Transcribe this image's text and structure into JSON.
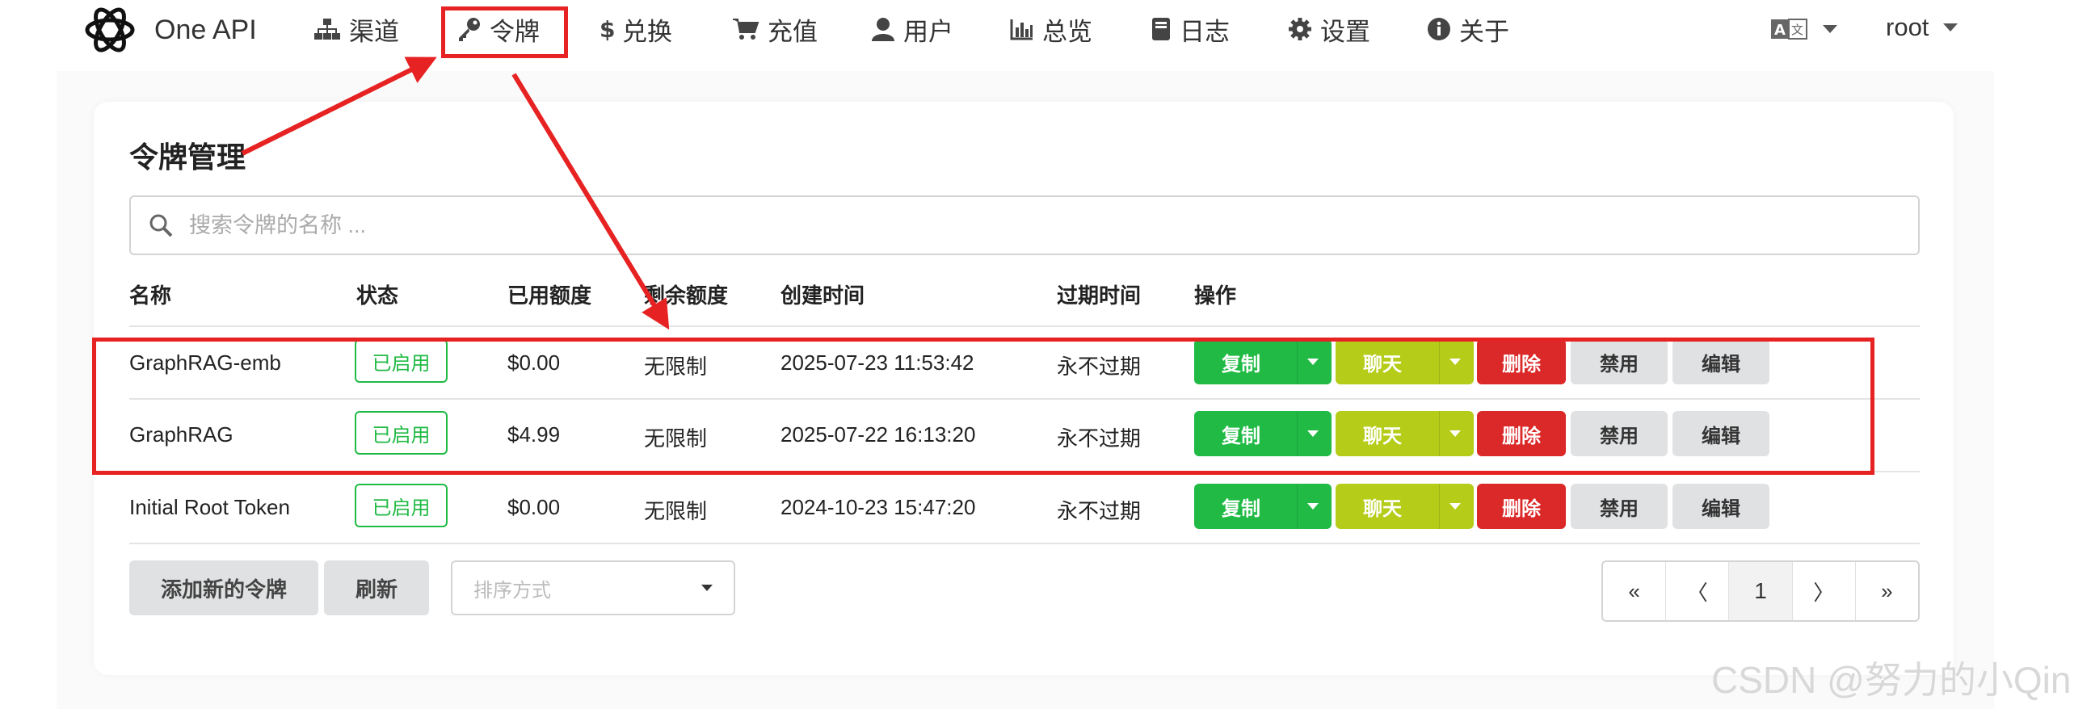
{
  "header": {
    "brand": "One API",
    "nav": [
      {
        "label": "渠道",
        "icon": "sitemap-icon"
      },
      {
        "label": "令牌",
        "icon": "key-icon"
      },
      {
        "label": "兑换",
        "icon": "dollar-icon"
      },
      {
        "label": "充值",
        "icon": "cart-icon"
      },
      {
        "label": "用户",
        "icon": "user-icon"
      },
      {
        "label": "总览",
        "icon": "bar-chart-icon"
      },
      {
        "label": "日志",
        "icon": "book-icon"
      },
      {
        "label": "设置",
        "icon": "gear-icon"
      },
      {
        "label": "关于",
        "icon": "info-icon"
      }
    ],
    "language_icon": "translate-icon",
    "user": "root"
  },
  "page": {
    "title": "令牌管理",
    "search_placeholder": "搜索令牌的名称 ..."
  },
  "table": {
    "columns": [
      "名称",
      "状态",
      "已用额度",
      "剩余额度",
      "创建时间",
      "过期时间",
      "操作"
    ],
    "rows": [
      {
        "name": "GraphRAG-emb",
        "status": "已启用",
        "used": "$0.00",
        "remaining": "无限制",
        "created": "2025-07-23 11:53:42",
        "expires": "永不过期"
      },
      {
        "name": "GraphRAG",
        "status": "已启用",
        "used": "$4.99",
        "remaining": "无限制",
        "created": "2025-07-22 16:13:20",
        "expires": "永不过期"
      },
      {
        "name": "Initial Root Token",
        "status": "已启用",
        "used": "$0.00",
        "remaining": "无限制",
        "created": "2024-10-23 15:47:20",
        "expires": "永不过期"
      }
    ],
    "actions": {
      "copy": "复制",
      "chat": "聊天",
      "delete": "删除",
      "disable": "禁用",
      "edit": "编辑"
    }
  },
  "footer": {
    "add_label": "添加新的令牌",
    "refresh_label": "刷新",
    "sort_placeholder": "排序方式",
    "pagination": {
      "first": "«",
      "prev": "〈",
      "current": "1",
      "next": "〉",
      "last": "»"
    }
  },
  "watermark": "CSDN @努力的小Qin",
  "colors": {
    "green": "#21ba45",
    "olive": "#b5cc18",
    "red": "#db2828",
    "annotation": "#e62222"
  }
}
